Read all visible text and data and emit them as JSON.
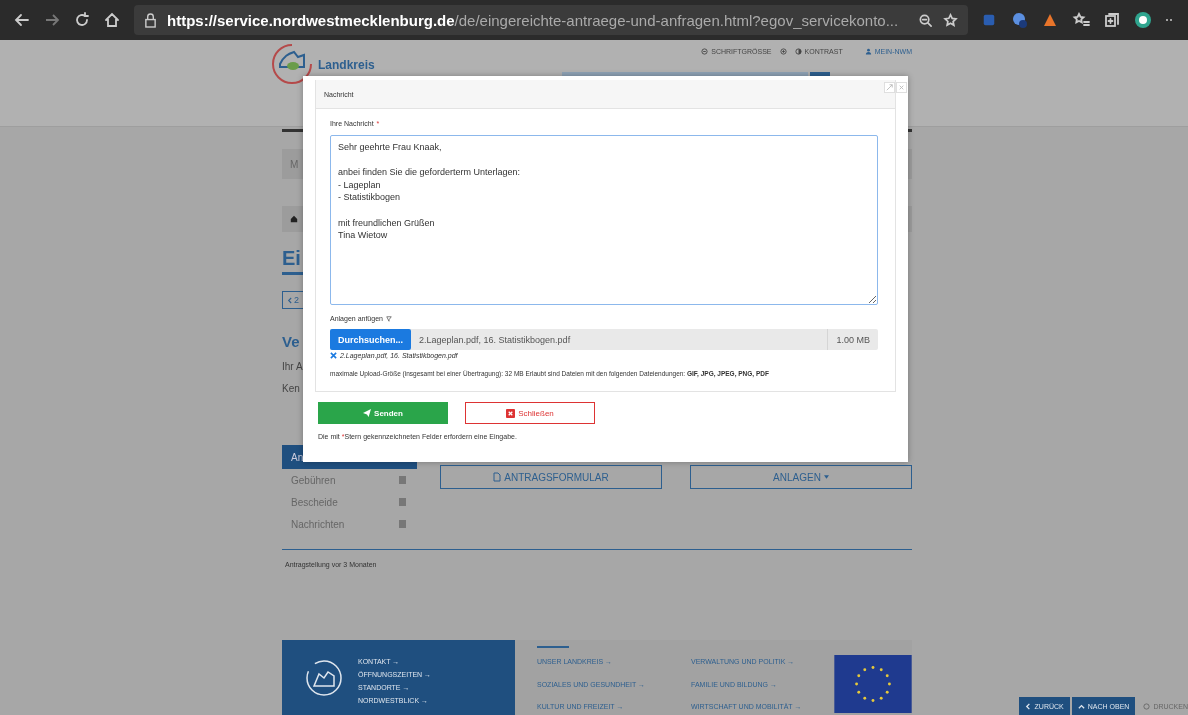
{
  "browser": {
    "url_host": "https://service.nordwestmecklenburg.de",
    "url_path": "/de/eingereichte-antraege-und-anfragen.html?egov_servicekonto..."
  },
  "header": {
    "logo_text": "Landkreis",
    "links": [
      "SCHRIFTGRÖSSE",
      "KONTRAST",
      "MEIN-NWM"
    ]
  },
  "page": {
    "nav_fragment": "M",
    "heading_fragment": "Ei",
    "back_fragment": "2",
    "section_fragment": "Ve",
    "line_fragments": [
      "Ihr A",
      "Ken"
    ],
    "tab_fragment": "An",
    "sidebar": [
      {
        "label": "Gebühren"
      },
      {
        "label": "Bescheide"
      },
      {
        "label": "Nachrichten"
      }
    ],
    "buttons": [
      {
        "kind": "document",
        "label": "ANTRAGSFORMULAR"
      },
      {
        "kind": "dropdown",
        "label": "ANLAGEN"
      }
    ],
    "note": "Antragstellung vor 3 Monaten"
  },
  "footer": {
    "contact_links": [
      "KONTAKT →",
      "ÖFFNUNGSZEITEN →",
      "STANDORTE →",
      "NORDWESTBLICK →"
    ],
    "links": [
      "UNSER LANDKREIS →",
      "SOZIALES UND GESUNDHEIT →",
      "KULTUR UND FREIZEIT →",
      "VERWALTUNG UND POLITIK →",
      "FAMILIE UND BILDUNG →",
      "WIRTSCHAFT UND MOBILITÄT →"
    ]
  },
  "page_tools": [
    {
      "kind": "back",
      "label": "ZURÜCK"
    },
    {
      "kind": "top",
      "label": "NACH OBEN"
    },
    {
      "kind": "print",
      "label": "DRUCKEN"
    }
  ],
  "dialog": {
    "title": "Nachricht",
    "message": {
      "label": "Ihre Nachricht",
      "required_mark": "*",
      "paragraphs": [
        [
          "Sehr geehrte Frau Knaak,"
        ],
        [
          "anbei finden Sie die geforderterm Unterlagen:",
          "- Lageplan",
          "- Statistikbogen"
        ],
        [
          "mit freundlichen Grüßen",
          "Tina Wietow"
        ]
      ]
    },
    "attachments": {
      "label": "Anlagen anfügen",
      "browse": "Durchsuchen...",
      "files": "2.Lageplan.pdf, 16. Statistikbogen.pdf",
      "size": "1.00 MB",
      "selected": "2.Lageplan.pdf, 16. Statistikbogen.pdf",
      "hint": "maximale Upload-Größe (insgesamt bei einer Übertragung): 32 MB Erlaubt sind Dateien mit den folgenden Dateiendungen: **GIF, JPG, JPEG, PNG, PDF**"
    },
    "send": "Senden",
    "close": "Schließen",
    "note": {
      "before": "Die mit ",
      "mark": "*",
      "after": "Stern gekennzeichneten Felder erfordern eine Eingabe."
    }
  }
}
